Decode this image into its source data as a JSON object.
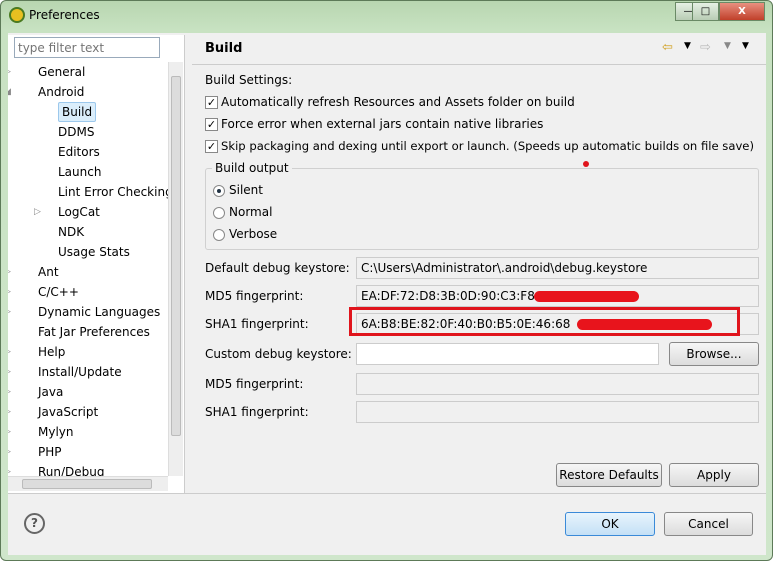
{
  "window": {
    "title": "Preferences",
    "min": "—",
    "max": "□",
    "close": "X"
  },
  "sidebar": {
    "filter_placeholder": "type filter text",
    "items": [
      {
        "label": "General",
        "level": 0,
        "twisty": "▷"
      },
      {
        "label": "Android",
        "level": 0,
        "twisty": "◢"
      },
      {
        "label": "Build",
        "level": 1,
        "twisty": "",
        "selected": true
      },
      {
        "label": "DDMS",
        "level": 1,
        "twisty": ""
      },
      {
        "label": "Editors",
        "level": 1,
        "twisty": ""
      },
      {
        "label": "Launch",
        "level": 1,
        "twisty": ""
      },
      {
        "label": "Lint Error Checking",
        "level": 1,
        "twisty": ""
      },
      {
        "label": "LogCat",
        "level": 1,
        "twisty": "▷"
      },
      {
        "label": "NDK",
        "level": 1,
        "twisty": ""
      },
      {
        "label": "Usage Stats",
        "level": 1,
        "twisty": ""
      },
      {
        "label": "Ant",
        "level": 0,
        "twisty": "▷"
      },
      {
        "label": "C/C++",
        "level": 0,
        "twisty": "▷"
      },
      {
        "label": "Dynamic Languages",
        "level": 0,
        "twisty": "▷"
      },
      {
        "label": "Fat Jar Preferences",
        "level": 0,
        "twisty": ""
      },
      {
        "label": "Help",
        "level": 0,
        "twisty": "▷"
      },
      {
        "label": "Install/Update",
        "level": 0,
        "twisty": "▷"
      },
      {
        "label": "Java",
        "level": 0,
        "twisty": "▷"
      },
      {
        "label": "JavaScript",
        "level": 0,
        "twisty": "▷"
      },
      {
        "label": "Mylyn",
        "level": 0,
        "twisty": "▷"
      },
      {
        "label": "PHP",
        "level": 0,
        "twisty": "▷"
      },
      {
        "label": "Run/Debug",
        "level": 0,
        "twisty": "▷"
      }
    ]
  },
  "page": {
    "title": "Build",
    "build_settings_label": "Build Settings:",
    "checkboxes": [
      {
        "label": "Automatically refresh Resources and Assets folder on build",
        "checked": true
      },
      {
        "label": "Force error when external jars contain native libraries",
        "checked": true
      },
      {
        "label": "Skip packaging and dexing until export or launch. (Speeds up automatic builds on file save)",
        "checked": true
      }
    ],
    "build_output": {
      "label": "Build output",
      "options": [
        "Silent",
        "Normal",
        "Verbose"
      ],
      "selected": "Silent"
    },
    "default_keystore_label": "Default debug keystore:",
    "default_keystore_value": "C:\\Users\\Administrator\\.android\\debug.keystore",
    "md5_label": "MD5 fingerprint:",
    "md5_value": "EA:DF:72:D8:3B:0D:90:C3:F8:E9",
    "sha1_label": "SHA1 fingerprint:",
    "sha1_value": "6A:B8:BE:82:0F:40:B0:B5:0E:46:68",
    "custom_keystore_label": "Custom debug keystore:",
    "custom_keystore_value": "",
    "browse": "Browse...",
    "custom_md5_label": "MD5 fingerprint:",
    "custom_sha1_label": "SHA1 fingerprint:",
    "restore_defaults": "Restore Defaults",
    "apply": "Apply",
    "highlight_color": "#e0141c"
  },
  "footer": {
    "ok": "OK",
    "cancel": "Cancel",
    "help": "?"
  }
}
